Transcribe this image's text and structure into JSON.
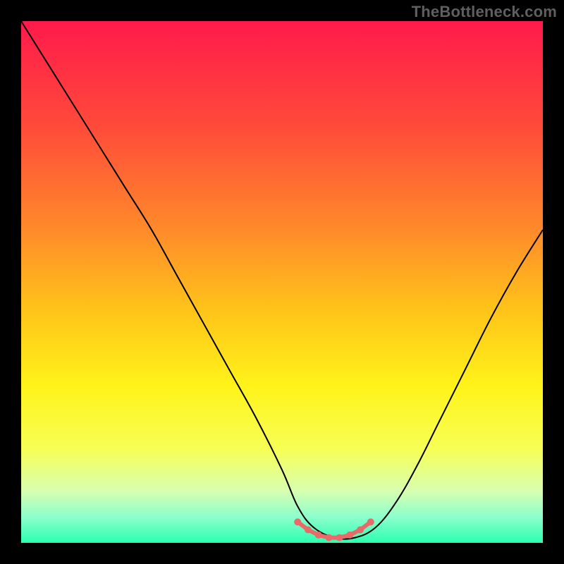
{
  "watermark": "TheBottleneck.com",
  "colors": {
    "bg": "#000000",
    "curve_stroke": "#000000",
    "marker_fill": "#e86a6a",
    "watermark_text": "#5f5f5f"
  },
  "chart_data": {
    "type": "line",
    "title": "",
    "xlabel": "",
    "ylabel": "",
    "xlim": [
      0,
      100
    ],
    "ylim": [
      0,
      100
    ],
    "legend": false,
    "grid": false,
    "gradient_bands": [
      {
        "stop": 0.0,
        "color": "#ff1a4b"
      },
      {
        "stop": 0.2,
        "color": "#ff4a3a"
      },
      {
        "stop": 0.4,
        "color": "#ff8a2a"
      },
      {
        "stop": 0.55,
        "color": "#ffc21a"
      },
      {
        "stop": 0.7,
        "color": "#fff31a"
      },
      {
        "stop": 0.82,
        "color": "#f7ff55"
      },
      {
        "stop": 0.9,
        "color": "#d8ffb0"
      },
      {
        "stop": 0.95,
        "color": "#8dffcc"
      },
      {
        "stop": 1.0,
        "color": "#2bffb0"
      }
    ],
    "series": [
      {
        "name": "bottleneck-curve",
        "x": [
          0,
          5,
          10,
          15,
          20,
          25,
          30,
          35,
          40,
          45,
          50,
          53,
          56,
          60,
          64,
          68,
          72,
          76,
          80,
          85,
          90,
          95,
          100
        ],
        "y": [
          100,
          92,
          84,
          76,
          68,
          60,
          51,
          42,
          33,
          24,
          14,
          7,
          3,
          1,
          1,
          3,
          8,
          15,
          23,
          33,
          43,
          52,
          60
        ]
      }
    ],
    "markers": {
      "name": "optimal-range",
      "x": [
        53,
        55,
        57,
        59,
        61,
        63,
        65,
        67
      ],
      "y": [
        4,
        2.5,
        1.5,
        1,
        1,
        1.5,
        2.5,
        4
      ]
    }
  }
}
